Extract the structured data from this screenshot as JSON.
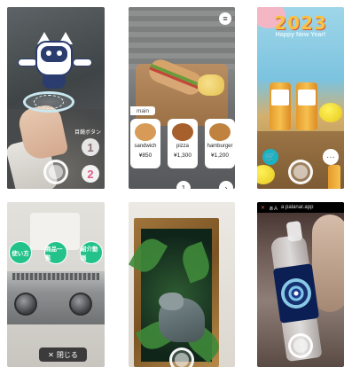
{
  "tile1": {
    "side_label": "目鏡ボタン",
    "num_buttons": [
      "1",
      "2"
    ]
  },
  "tile2": {
    "menu_icon": "≡",
    "tab_label": "main",
    "items": [
      {
        "name": "sandwich",
        "price": "¥850",
        "color": "#d79b57"
      },
      {
        "name": "pizza",
        "price": "¥1,300",
        "color": "#a7602c"
      },
      {
        "name": "hamburger",
        "price": "¥1,200",
        "color": "#c0823f"
      }
    ],
    "page_number": "1",
    "next_icon": "›"
  },
  "tile3": {
    "year": "2023",
    "greeting": "Happy New Year!",
    "cart_icon": "🛒",
    "more_icon": "···"
  },
  "tile4": {
    "buttons": [
      "使い方",
      "商品一覧",
      "紹介動画"
    ],
    "close_label": "閉じる",
    "close_icon": "✕"
  },
  "tile6": {
    "topbar_text": "a palanar.app",
    "topbar_left": "✕",
    "topbar_aa": "ぁA"
  },
  "colors": {
    "accent_green": "#23c28b",
    "cart_blue": "#18b3c4",
    "year_yellow": "#f6c343"
  }
}
